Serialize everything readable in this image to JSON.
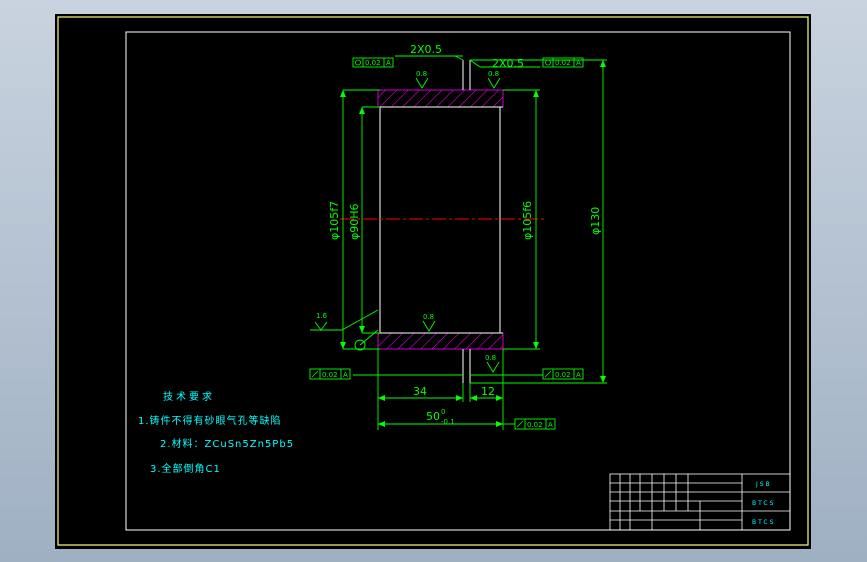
{
  "colors": {
    "background": "#000000",
    "frame": "#ffff80",
    "border": "#ffffff",
    "dimension": "#00ff00",
    "hatch": "#ff00ff",
    "centerline": "#ff0000",
    "text": "#00ffff"
  },
  "drawing": {
    "chamfer_left": "2X0.5",
    "chamfer_right": "2X0.5",
    "dia_outer_left": "φ105f7",
    "dia_bore": "φ90H6",
    "dia_outer_right": "φ105f6",
    "dia_flange": "φ130",
    "len_34": "34",
    "len_12": "12",
    "len_50": "50",
    "len_50_tol": "0",
    "len_50_tol_low": "-0.1",
    "roughness_top_left": "0.8",
    "roughness_top_right": "0.8",
    "roughness_mid": "0.8",
    "roughness_bottom": "0.8",
    "roughness_left": "1.6",
    "datum_a": "A",
    "tol_top_left": "0.02",
    "tol_top_right": "0.02",
    "tol_bottom_left": "0.02",
    "tol_bottom_right": "0.02",
    "tol_len50": "0.02"
  },
  "notes": {
    "title": "技术要求",
    "line1": "1.铸件不得有砂眼气孔等缺陷",
    "line2": "2.材料：ZCuSn5Zn5Pb5",
    "line3": "3.全部倒角C1"
  },
  "title_block": {
    "cell1": "JSB",
    "cell2": "BTCS",
    "cell3": "BTCS"
  }
}
